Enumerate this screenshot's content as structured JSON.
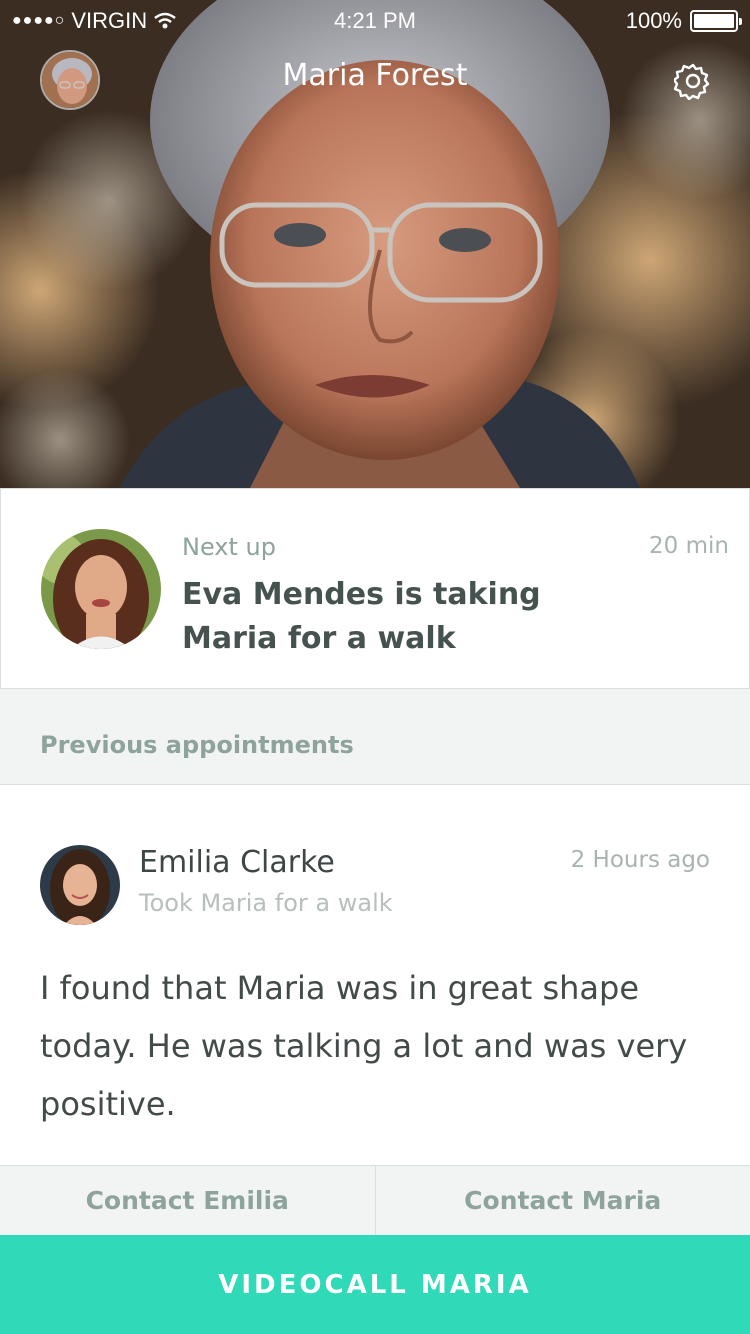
{
  "status_bar": {
    "carrier": "VIRGIN",
    "time": "4:21 PM",
    "battery": "100%"
  },
  "header": {
    "title": "Maria Forest"
  },
  "next_up": {
    "label": "Next up",
    "duration": "20 min",
    "description": "Eva Mendes is taking Maria for a walk"
  },
  "previous": {
    "section_title": "Previous appointments",
    "appointment": {
      "name": "Emilia Clarke",
      "activity": "Took Maria for a walk",
      "time_ago": "2 Hours ago",
      "note": "I found that Maria was in great shape today. He was talking a lot and was very positive."
    }
  },
  "actions": {
    "contact_left": "Contact Emilia",
    "contact_right": "Contact Maria",
    "videocall": "VIDEOCALL MARIA"
  },
  "colors": {
    "accent": "#30d9b8",
    "muted_green": "#8ea39c"
  }
}
